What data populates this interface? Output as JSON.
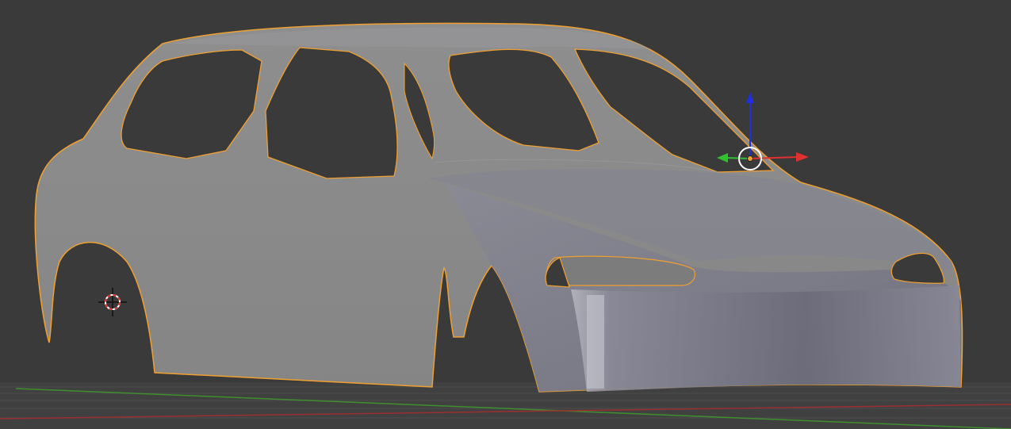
{
  "viewport": {
    "background_color": "#3a3a3a",
    "grid_floor_color": "#444444",
    "grid_line_color": "#505050",
    "x_axis_color": "#9b2f2f",
    "y_axis_color": "#3f8f2f"
  },
  "object": {
    "type": "mesh",
    "shape": "hatchback-car-body",
    "selected": true,
    "selection_outline_color": "#f0a030",
    "body_color_side": "#8c8c8c",
    "body_color_front": "#7d7d8a"
  },
  "transform_gizmo": {
    "x_color": "#e03030",
    "y_color": "#30c030",
    "z_color": "#2030e0",
    "pivot_color": "#f0a030",
    "ring_color": "#ffffff"
  },
  "cursor_3d": {
    "ring_color_a": "#e03030",
    "ring_color_b": "#ffffff",
    "crosshair_color": "#111111"
  }
}
